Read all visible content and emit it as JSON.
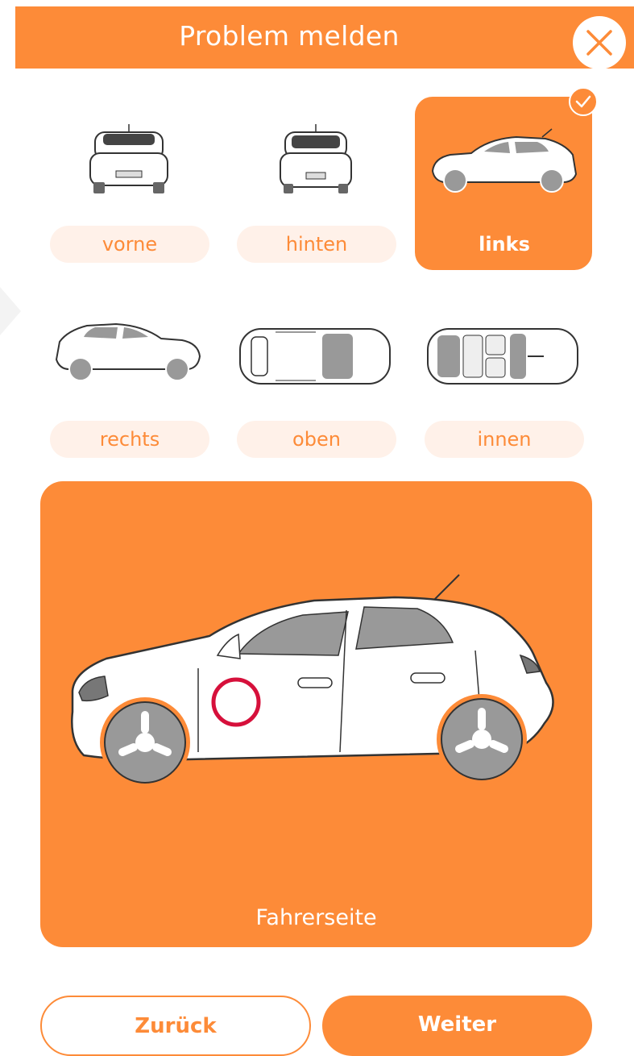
{
  "header": {
    "title": "Problem melden"
  },
  "views": [
    {
      "key": "vorne",
      "label": "vorne",
      "selected": false,
      "icon": "car-front-icon"
    },
    {
      "key": "hinten",
      "label": "hinten",
      "selected": false,
      "icon": "car-rear-icon"
    },
    {
      "key": "links",
      "label": "links",
      "selected": true,
      "icon": "car-side-left-icon"
    },
    {
      "key": "rechts",
      "label": "rechts",
      "selected": false,
      "icon": "car-side-right-icon"
    },
    {
      "key": "oben",
      "label": "oben",
      "selected": false,
      "icon": "car-top-icon"
    },
    {
      "key": "innen",
      "label": "innen",
      "selected": false,
      "icon": "car-interior-icon"
    }
  ],
  "preview": {
    "caption": "Fahrerseite",
    "marker": "damage-marker"
  },
  "actions": {
    "back_label": "Zurück",
    "next_label": "Weiter"
  },
  "colors": {
    "accent": "#fd8b38",
    "chip_bg": "#fff1e9",
    "marker": "#d6103b",
    "car_glass": "#999999"
  }
}
